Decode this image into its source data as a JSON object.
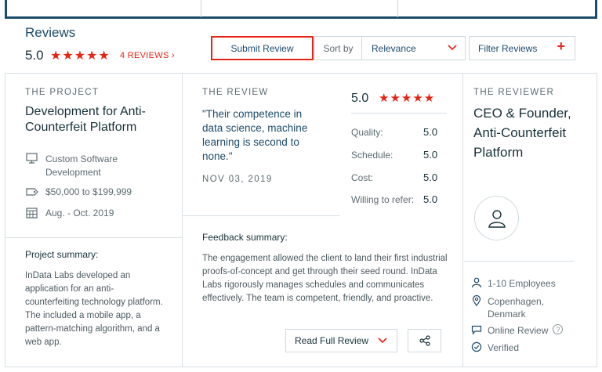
{
  "header": {
    "title": "Reviews",
    "overall_score": "5.0",
    "stars": "★★★★★",
    "count_link": "4 REVIEWS ›",
    "submit_label": "Submit Review",
    "sort_label": "Sort by",
    "sort_value": "Relevance",
    "filter_label": "Filter Reviews",
    "filter_plus": "+"
  },
  "project": {
    "caption": "THE PROJECT",
    "title": "Development for Anti-Counterfeit Platform",
    "service": "Custom Software Development",
    "budget": "$50,000 to $199,999",
    "timeline": "Aug. - Oct. 2019",
    "summary_heading": "Project summary:",
    "summary_text": "InData Labs developed an application for an anti-counterfeiting technology platform. The included a mobile app, a pattern-matching algorithm, and a web app."
  },
  "review": {
    "caption": "THE REVIEW",
    "quote": "\"Their competence in data science, machine learning is second to none.\"",
    "date": "NOV 03, 2019",
    "score": "5.0",
    "stars": "★★★★★",
    "ratings": [
      {
        "label": "Quality:",
        "value": "5.0"
      },
      {
        "label": "Schedule:",
        "value": "5.0"
      },
      {
        "label": "Cost:",
        "value": "5.0"
      },
      {
        "label": "Willing to refer:",
        "value": "5.0"
      }
    ],
    "feedback_heading": "Feedback summary:",
    "feedback_text": "The engagement allowed the client to land their first industrial proofs-of-concept and get through their seed round. InData Labs rigorously manages schedules and communicates effectively. The team is competent, friendly, and proactive.",
    "read_full_label": "Read Full Review"
  },
  "reviewer": {
    "caption": "THE REVIEWER",
    "title": "CEO & Founder, Anti-Counterfeit Platform",
    "employees": "1-10 Employees",
    "location": "Copenhagen, Denmark",
    "review_type": "Online Review",
    "verified": "Verified",
    "help": "?"
  },
  "colors": {
    "accent_red": "#e62415",
    "brand_navy": "#1c4b6c",
    "border": "#d7e0e5"
  }
}
